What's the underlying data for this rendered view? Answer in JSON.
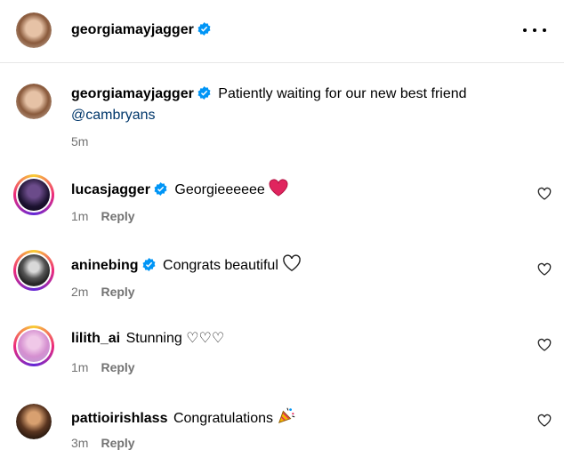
{
  "header": {
    "username": "georgiamayjagger",
    "more_icon": "ellipsis-icon"
  },
  "caption": {
    "username": "georgiamayjagger",
    "text": "Patiently waiting for our new best friend",
    "mention": "@cambryans",
    "time": "5m"
  },
  "comments": [
    {
      "username": "lucasjagger",
      "verified": true,
      "text": "Georgieeeeee",
      "emoji": "red-heart",
      "time": "1m",
      "reply": "Reply"
    },
    {
      "username": "aninebing",
      "verified": true,
      "text": "Congrats beautiful",
      "emoji": "white-heart",
      "time": "2m",
      "reply": "Reply"
    },
    {
      "username": "lilith_ai",
      "verified": false,
      "text": "Stunning ♡♡♡",
      "emoji": "",
      "time": "1m",
      "reply": "Reply"
    },
    {
      "username": "pattioirishlass",
      "verified": false,
      "text": "Congratulations",
      "emoji": "party-popper",
      "time": "3m",
      "reply": "Reply"
    }
  ],
  "colors": {
    "verified": "#0095f6",
    "meta": "#737373",
    "heart": "#e0245e"
  }
}
